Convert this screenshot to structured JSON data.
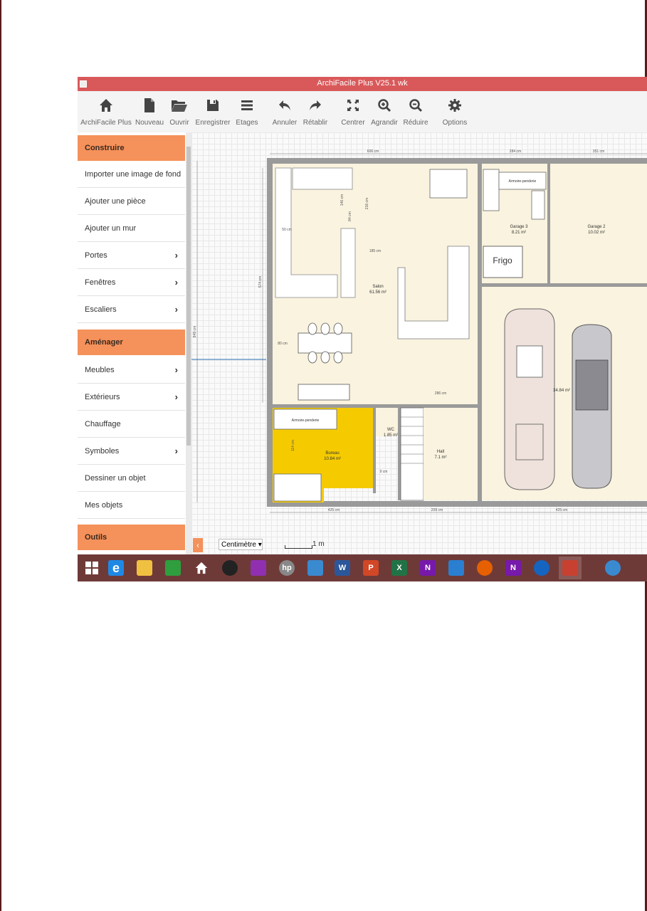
{
  "app": {
    "title": "ArchiFacile Plus V25.1 wk"
  },
  "toolbar": {
    "items": [
      {
        "label": "ArchiFacile Plus",
        "icon": "home-icon"
      },
      {
        "label": "Nouveau",
        "icon": "new-file-icon"
      },
      {
        "label": "Ouvrir",
        "icon": "folder-open-icon"
      },
      {
        "label": "Enregistrer",
        "icon": "save-icon"
      },
      {
        "label": "Etages",
        "icon": "layers-icon"
      },
      {
        "label": "Annuler",
        "icon": "undo-icon"
      },
      {
        "label": "Rétablir",
        "icon": "redo-icon"
      },
      {
        "label": "Centrer",
        "icon": "center-icon"
      },
      {
        "label": "Agrandir",
        "icon": "zoom-in-icon"
      },
      {
        "label": "Réduire",
        "icon": "zoom-out-icon"
      },
      {
        "label": "Options",
        "icon": "gear-icon"
      }
    ]
  },
  "sidebar": {
    "sections": [
      {
        "title": "Construire",
        "items": [
          {
            "label": "Importer une image de fond",
            "chevron": false
          },
          {
            "label": "Ajouter une pièce",
            "chevron": false
          },
          {
            "label": "Ajouter un mur",
            "chevron": false
          },
          {
            "label": "Portes",
            "chevron": true
          },
          {
            "label": "Fenêtres",
            "chevron": true
          },
          {
            "label": "Escaliers",
            "chevron": true
          }
        ]
      },
      {
        "title": "Aménager",
        "items": [
          {
            "label": "Meubles",
            "chevron": true
          },
          {
            "label": "Extérieurs",
            "chevron": true
          },
          {
            "label": "Chauffage",
            "chevron": false
          },
          {
            "label": "Symboles",
            "chevron": true
          },
          {
            "label": "Dessiner un objet",
            "chevron": false
          },
          {
            "label": "Mes objets",
            "chevron": false
          }
        ]
      },
      {
        "title": "Outils",
        "items": []
      }
    ]
  },
  "plan": {
    "rooms": {
      "salon": {
        "name": "Salon",
        "area": "61.56 m²"
      },
      "bureau": {
        "name": "Bureau",
        "area": "10.84 m²"
      },
      "wc": {
        "name": "WC",
        "area": "1.85 m²"
      },
      "hall": {
        "name": "Hall",
        "area": "7.1 m²"
      },
      "garage3": {
        "name": "Garage 3",
        "area": "8.21 m²"
      },
      "garage2": {
        "name": "Garage 2",
        "area": "10.02 m²"
      },
      "garage": {
        "area": "34.84 m²"
      }
    },
    "labels": {
      "armoire1": "Armoire-penderie",
      "armoire2": "Armoire-penderie",
      "frigo": "Frigo"
    },
    "dimensions": {
      "top_main": "606 cm",
      "top_g3": "284 cm",
      "top_g2": "351 cm",
      "bottom_left": "425 cm",
      "bottom_mid": "209 cm",
      "bottom_right": "425 cm",
      "left_outer": "849 cm",
      "left_inner": "574 cm",
      "salon_v": "216 cm",
      "kitchen_v": "146 cm",
      "kitchen_v2": "84 cm",
      "salon_h": "185 cm",
      "kitchen_h": "50 cm",
      "table": "80 cm",
      "hall_h": "286 cm",
      "bureau_v": "114 cm",
      "wc_d": "9 cm"
    }
  },
  "bottom": {
    "unit": "Centimètre",
    "scale": "1 m",
    "collapse": "‹"
  },
  "taskbar": {
    "items": [
      {
        "icon": "windows-start-icon",
        "color": "#6e3a38",
        "text": ""
      },
      {
        "icon": "internet-explorer-icon",
        "color": "#1e88e5",
        "text": "e"
      },
      {
        "icon": "file-explorer-icon",
        "color": "#f0c040",
        "text": ""
      },
      {
        "icon": "store-icon",
        "color": "#2e9e3e",
        "text": ""
      },
      {
        "icon": "home-app-icon",
        "color": "#6e3a38",
        "text": ""
      },
      {
        "icon": "camera-app-icon",
        "color": "#222222",
        "text": ""
      },
      {
        "icon": "photos-app-icon",
        "color": "#9030b0",
        "text": ""
      },
      {
        "icon": "hp-icon",
        "color": "#888888",
        "text": "hp"
      },
      {
        "icon": "network-app-icon",
        "color": "#3a8ad0",
        "text": ""
      },
      {
        "icon": "word-icon",
        "color": "#2b579a",
        "text": "W"
      },
      {
        "icon": "powerpoint-icon",
        "color": "#d24726",
        "text": "P"
      },
      {
        "icon": "excel-icon",
        "color": "#217346",
        "text": "X"
      },
      {
        "icon": "onenote-icon",
        "color": "#7719aa",
        "text": "N"
      },
      {
        "icon": "maps-app-icon",
        "color": "#2a7fd0",
        "text": ""
      },
      {
        "icon": "firefox-icon",
        "color": "#e66000",
        "text": ""
      },
      {
        "icon": "onenote-clip-icon",
        "color": "#7719aa",
        "text": "N"
      },
      {
        "icon": "app-blue-icon",
        "color": "#1565c0",
        "text": ""
      },
      {
        "icon": "archifacile-icon",
        "color": "#c84030",
        "text": ""
      },
      {
        "icon": "notification-icon",
        "color": "#3a8ad0",
        "text": ""
      }
    ]
  }
}
